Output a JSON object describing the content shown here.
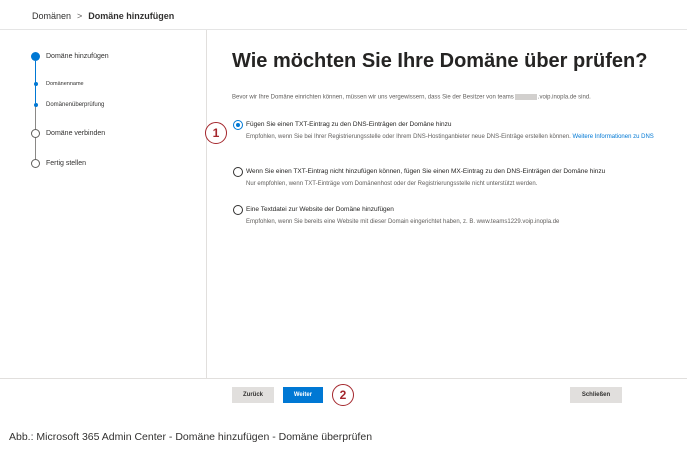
{
  "breadcrumb": {
    "root": "Domänen",
    "separator": ">",
    "current": "Domäne hinzufügen"
  },
  "steps": [
    {
      "label": "Domäne hinzufügen",
      "state": "done"
    },
    {
      "label": "Domänenname",
      "state": "done-sub"
    },
    {
      "label": "Domänenüberprüfung",
      "state": "current-sub"
    },
    {
      "label": "Domäne verbinden",
      "state": "pending"
    },
    {
      "label": "Fertig stellen",
      "state": "pending"
    }
  ],
  "main": {
    "title": "Wie möchten Sie Ihre Domäne über prüfen?",
    "intro_prefix": "Bevor wir Ihre Domäne einrichten können, müssen wir uns vergewissern, dass Sie der Besitzer von teams",
    "intro_suffix": ".voip.inopla.de sind.",
    "options": [
      {
        "label": "Fügen Sie einen TXT-Eintrag zu den DNS-Einträgen der Domäne hinzu",
        "desc": "Empfohlen, wenn Sie bei Ihrer Registrierungsstelle oder Ihrem DNS-Hostinganbieter neue DNS-Einträge erstellen können.",
        "link": "Weitere Informationen zu DNS",
        "checked": true
      },
      {
        "label": "Wenn Sie einen TXT-Eintrag nicht hinzufügen können, fügen Sie einen MX-Eintrag zu den DNS-Einträgen der Domäne hinzu",
        "desc": "Nur empfohlen, wenn TXT-Einträge vom Domänenhost oder der Registrierungsstelle nicht unterstützt werden.",
        "checked": false
      },
      {
        "label": "Eine Textdatei zur Website der Domäne hinzufügen",
        "desc": "Empfohlen, wenn Sie bereits eine Website mit dieser Domain eingerichtet haben, z. B. www.teams1229.voip.inopla.de",
        "checked": false
      }
    ]
  },
  "callouts": {
    "first": "1",
    "second": "2"
  },
  "footer": {
    "back_label": "Zurück",
    "next_label": "Weiter",
    "close_label": "Schließen"
  },
  "caption": "Abb.: Microsoft 365 Admin Center - Domäne hinzufügen - Domäne überprüfen",
  "colors": {
    "accent": "#0078d4",
    "callout": "#a4262c"
  }
}
